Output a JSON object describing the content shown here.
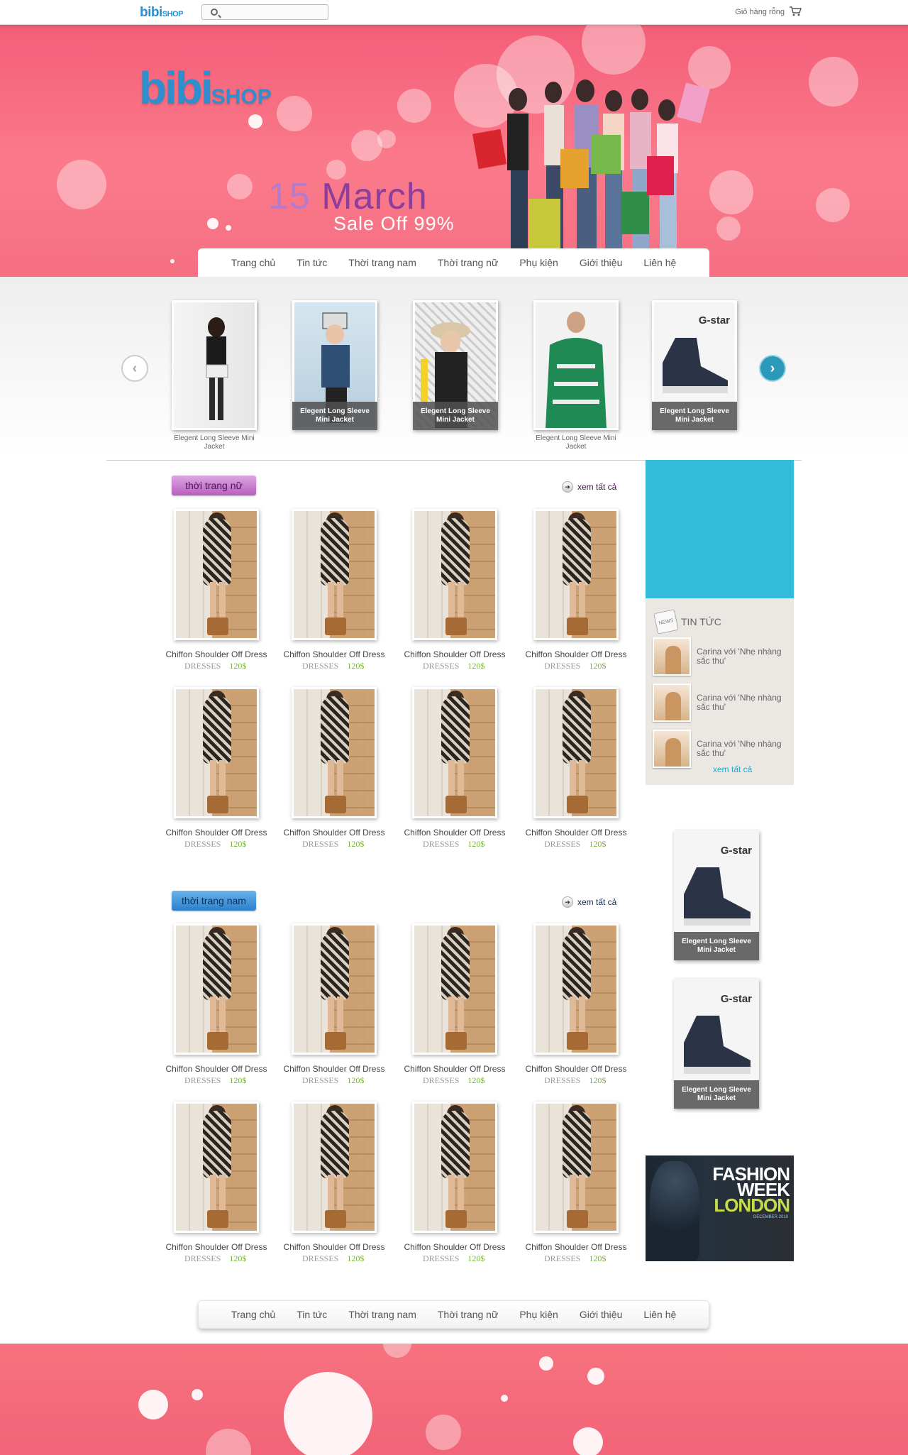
{
  "topbar": {
    "logo_main": "bibi",
    "logo_suffix": "SHOP",
    "search_placeholder": "",
    "cart_label": "Giỏ hàng rỗng"
  },
  "banner": {
    "logo_main": "bibi",
    "logo_suffix": "SHOP",
    "promo_day": "15",
    "promo_month": "March",
    "promo_sale": "Sale Off 99%"
  },
  "nav": {
    "items": [
      "Trang chủ",
      "Tin tức",
      "Thời trang nam",
      "Thời trang nữ",
      "Phụ kiện",
      "Giới thiệu",
      "Liên hệ"
    ]
  },
  "carousel": {
    "slides": [
      {
        "caption_below": "Elegent Long Sleeve Mini Jacket",
        "caption_overlay": "",
        "brand": ""
      },
      {
        "caption_below": "",
        "caption_overlay": "Elegent Long Sleeve Mini Jacket",
        "brand": ""
      },
      {
        "caption_below": "",
        "caption_overlay": "Elegent Long Sleeve Mini Jacket",
        "brand": ""
      },
      {
        "caption_below": "Elegent Long Sleeve Mini Jacket",
        "caption_overlay": "",
        "brand": ""
      },
      {
        "caption_below": "",
        "caption_overlay": "Elegent Long Sleeve Mini Jacket",
        "brand": "G-star"
      }
    ]
  },
  "sections": {
    "women": {
      "title": "thời trang nữ",
      "see_all": "xem tất cả"
    },
    "men": {
      "title": "thời trang nam",
      "see_all": "xem tất cả"
    }
  },
  "product": {
    "title": "Chiffon Shoulder Off Dress",
    "category": "DRESSES",
    "price": "120$"
  },
  "news": {
    "heading": "TIN TỨC",
    "icon_label": "NEWS",
    "items": [
      "Carina với 'Nhẹ nhàng sắc thu'",
      "Carina với 'Nhẹ nhàng sắc thu'",
      "Carina với 'Nhẹ nhàng sắc thu'"
    ],
    "see_all": "xem tất cả"
  },
  "side_products": [
    {
      "brand": "G-star",
      "caption": "Elegent Long Sleeve Mini Jacket"
    },
    {
      "brand": "G-star",
      "caption": "Elegent Long Sleeve Mini Jacket"
    }
  ],
  "ad": {
    "line1": "FASHION",
    "line2": "WEEK",
    "line3": "LONDON",
    "date": "DECEMBER 2010"
  },
  "colors": {
    "brand_pink": "#f45e78",
    "accent_blue": "#33bcd9",
    "price_green": "#7ab33a"
  }
}
